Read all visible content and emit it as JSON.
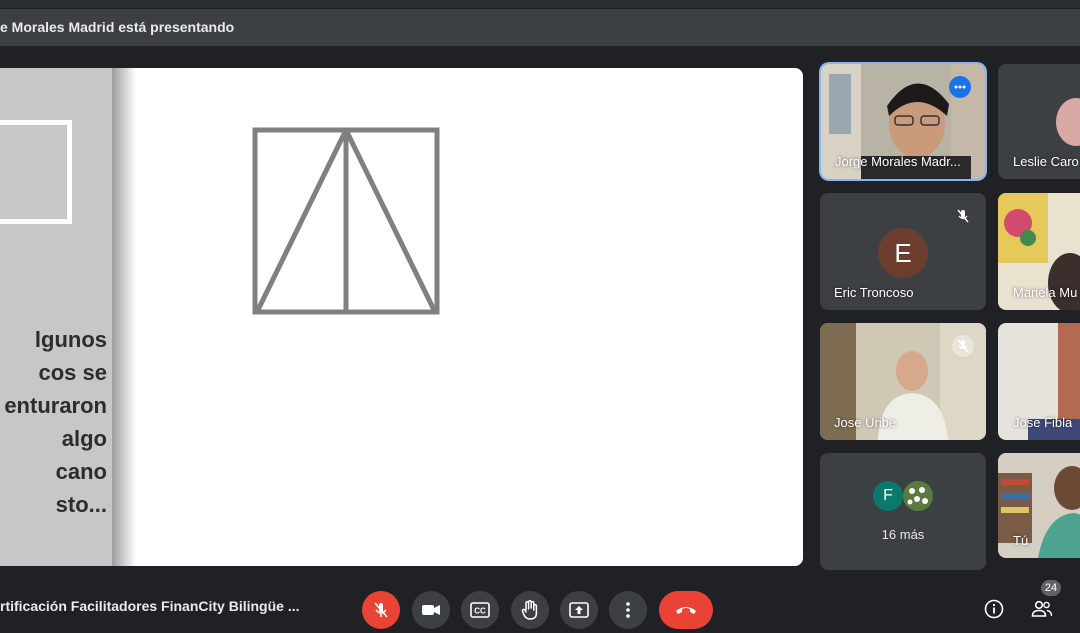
{
  "banner": {
    "presenting_text": "e Morales Madrid está presentando"
  },
  "slide": {
    "lines": [
      "lgunos",
      "cos se",
      "enturaron",
      "algo",
      "cano",
      "sto..."
    ]
  },
  "participants": {
    "active": {
      "name": "Jorge Morales Madr..."
    },
    "tiles": [
      {
        "name": "Leslie Caro"
      },
      {
        "name": "Eric Troncoso",
        "initial": "E"
      },
      {
        "name": "Mariela Mu"
      },
      {
        "name": "Jose Uribe"
      },
      {
        "name": "Jose Fibla"
      },
      {
        "name": "Tú"
      }
    ],
    "overflow": {
      "label": "16 más",
      "initial": "F"
    }
  },
  "bottom": {
    "meeting_title": "rtificación Facilitadores FinanCity Bilingüe ...",
    "participant_count": "24"
  }
}
